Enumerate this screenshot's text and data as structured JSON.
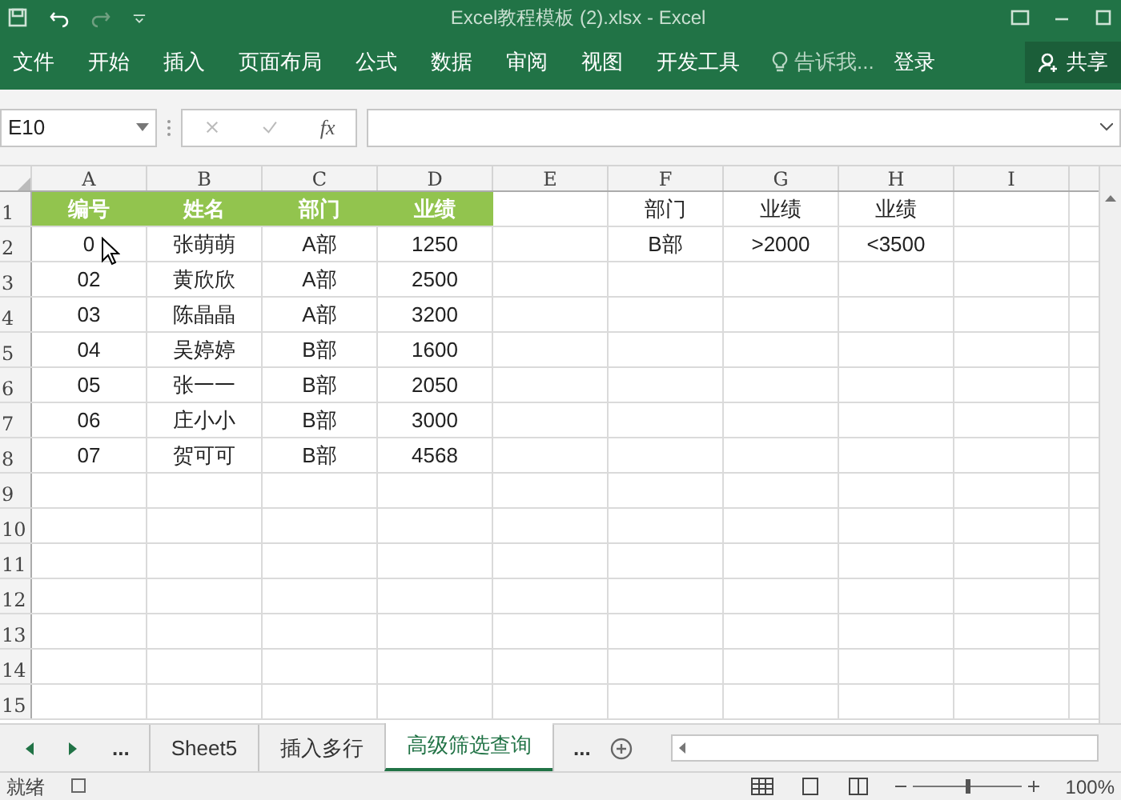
{
  "window": {
    "title": "Excel教程模板 (2).xlsx - Excel"
  },
  "ribbon_tabs": [
    {
      "label": "文件"
    },
    {
      "label": "开始"
    },
    {
      "label": "插入"
    },
    {
      "label": "页面布局"
    },
    {
      "label": "公式"
    },
    {
      "label": "数据"
    },
    {
      "label": "审阅"
    },
    {
      "label": "视图"
    },
    {
      "label": "开发工具"
    }
  ],
  "tell_me": {
    "placeholder": "告诉我..."
  },
  "sign_in": "登录",
  "share": "共享",
  "formula_bar": {
    "name_box": "E10",
    "fx": "fx"
  },
  "columns": [
    "A",
    "B",
    "C",
    "D",
    "E",
    "F",
    "G",
    "H",
    "I"
  ],
  "rows": [
    {
      "number": "1",
      "A": {
        "text": "编号",
        "kind": "header"
      },
      "B": {
        "text": "姓名",
        "kind": "header"
      },
      "C": {
        "text": "部门",
        "kind": "header"
      },
      "D": {
        "text": "业绩",
        "kind": "header"
      },
      "F": {
        "text": "部门",
        "kind": "plain"
      },
      "G": {
        "text": "业绩",
        "kind": "plain"
      },
      "H": {
        "text": "业绩",
        "kind": "plain"
      }
    },
    {
      "number": "2",
      "A": {
        "text": "0",
        "kind": "plain"
      },
      "B": {
        "text": "张萌萌",
        "kind": "plain"
      },
      "C": {
        "text": "A部",
        "kind": "plain"
      },
      "D": {
        "text": "1250",
        "kind": "plain"
      },
      "F": {
        "text": "B部",
        "kind": "plain"
      },
      "G": {
        "text": ">2000",
        "kind": "plain"
      },
      "H": {
        "text": "<3500",
        "kind": "plain"
      }
    },
    {
      "number": "3",
      "A": {
        "text": "02",
        "kind": "plain"
      },
      "B": {
        "text": "黄欣欣",
        "kind": "plain"
      },
      "C": {
        "text": "A部",
        "kind": "plain"
      },
      "D": {
        "text": "2500",
        "kind": "plain"
      }
    },
    {
      "number": "4",
      "A": {
        "text": "03",
        "kind": "plain"
      },
      "B": {
        "text": "陈晶晶",
        "kind": "plain"
      },
      "C": {
        "text": "A部",
        "kind": "plain"
      },
      "D": {
        "text": "3200",
        "kind": "plain"
      }
    },
    {
      "number": "5",
      "A": {
        "text": "04",
        "kind": "plain"
      },
      "B": {
        "text": "吴婷婷",
        "kind": "plain"
      },
      "C": {
        "text": "B部",
        "kind": "plain"
      },
      "D": {
        "text": "1600",
        "kind": "plain"
      }
    },
    {
      "number": "6",
      "A": {
        "text": "05",
        "kind": "plain"
      },
      "B": {
        "text": "张一一",
        "kind": "plain"
      },
      "C": {
        "text": "B部",
        "kind": "plain"
      },
      "D": {
        "text": "2050",
        "kind": "plain"
      }
    },
    {
      "number": "7",
      "A": {
        "text": "06",
        "kind": "plain"
      },
      "B": {
        "text": "庄小小",
        "kind": "plain"
      },
      "C": {
        "text": "B部",
        "kind": "plain"
      },
      "D": {
        "text": "3000",
        "kind": "plain"
      }
    },
    {
      "number": "8",
      "A": {
        "text": "07",
        "kind": "plain"
      },
      "B": {
        "text": "贺可可",
        "kind": "plain"
      },
      "C": {
        "text": "B部",
        "kind": "plain"
      },
      "D": {
        "text": "4568",
        "kind": "plain"
      }
    },
    {
      "number": "9"
    },
    {
      "number": "10"
    },
    {
      "number": "11"
    },
    {
      "number": "12"
    },
    {
      "number": "13"
    },
    {
      "number": "14"
    },
    {
      "number": "15"
    }
  ],
  "sheet_tabs": {
    "more_left": "...",
    "more_right": "...",
    "tabs": [
      {
        "label": "Sheet5",
        "selected": false
      },
      {
        "label": "插入多行",
        "selected": false
      },
      {
        "label": "高级筛选查询",
        "selected": true
      }
    ]
  },
  "status_bar": {
    "status": "就绪",
    "zoom_slider": {
      "level": 0.5
    },
    "zoom": "100%"
  }
}
